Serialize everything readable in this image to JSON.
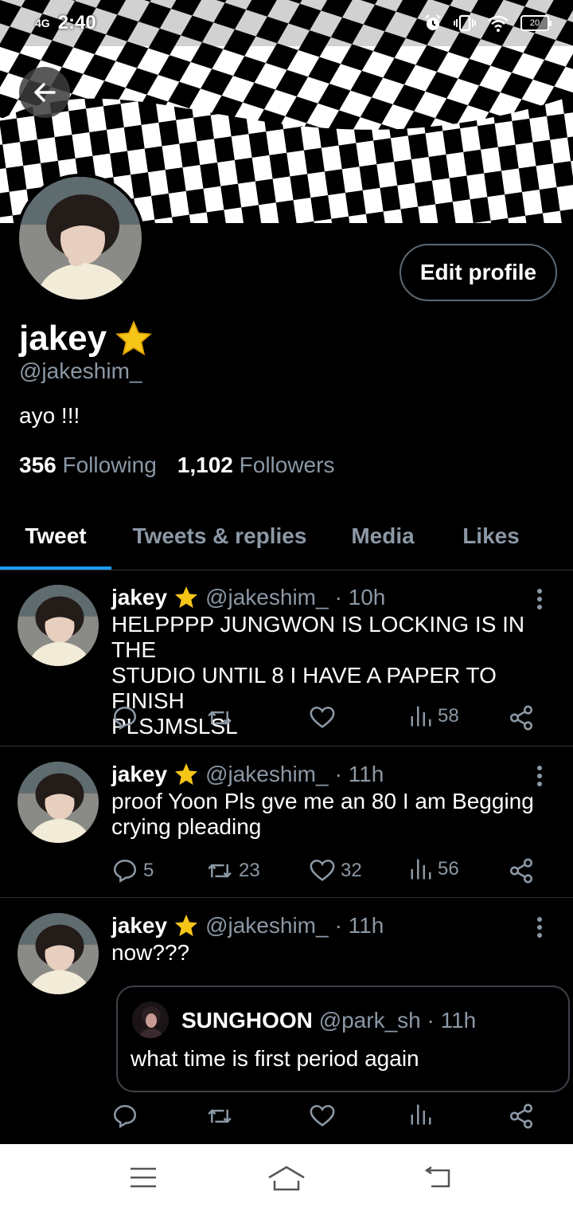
{
  "status_bar": {
    "network": "4G",
    "time": "2:40",
    "battery": "20"
  },
  "profile": {
    "display_name": "jakey",
    "handle": "@jakeshim_",
    "bio": "ayo !!!",
    "following_count": "356",
    "following_label": "Following",
    "followers_count": "1,102",
    "followers_label": "Followers",
    "edit_label": "Edit profile"
  },
  "tabs": [
    {
      "label": "Tweet",
      "active": true
    },
    {
      "label": "Tweets & replies",
      "active": false
    },
    {
      "label": "Media",
      "active": false
    },
    {
      "label": "Likes",
      "active": false
    }
  ],
  "tweets": [
    {
      "name": "jakey",
      "handle": "@jakeshim_",
      "time": "· 10h",
      "lines": [
        "HELPPPP JUNGWON IS LOCKING IS IN THE",
        "STUDIO UNTIL 8 I HAVE A PAPER TO FINISH",
        "PLSJMSLSL"
      ],
      "replies": "",
      "retweets": "",
      "likes": "",
      "views": "58"
    },
    {
      "name": "jakey",
      "handle": "@jakeshim_",
      "time": "· 11h",
      "lines": [
        "proof Yoon Pls gve me an 80 I am Begging",
        "crying pleading"
      ],
      "replies": "5",
      "retweets": "23",
      "likes": "32",
      "views": "56"
    },
    {
      "name": "jakey",
      "handle": "@jakeshim_",
      "time": "· 11h",
      "lines": [
        "now???"
      ],
      "replies": "",
      "retweets": "",
      "likes": "",
      "views": "",
      "quote": {
        "name": "SUNGHOON",
        "handle": "@park_sh",
        "time": "· 11h",
        "text": "what time is first period again"
      }
    }
  ],
  "colors": {
    "accent": "#1d9bf0",
    "muted": "#8b98a5",
    "star": "#f5c518",
    "border": "#2f3336"
  },
  "icons": [
    "back-arrow-icon",
    "alarm-icon",
    "vibrate-icon",
    "wifi-icon",
    "battery-icon",
    "star-icon",
    "reply-icon",
    "retweet-icon",
    "like-icon",
    "views-icon",
    "share-icon",
    "more-icon",
    "menu-icon",
    "home-icon",
    "back-nav-icon"
  ]
}
